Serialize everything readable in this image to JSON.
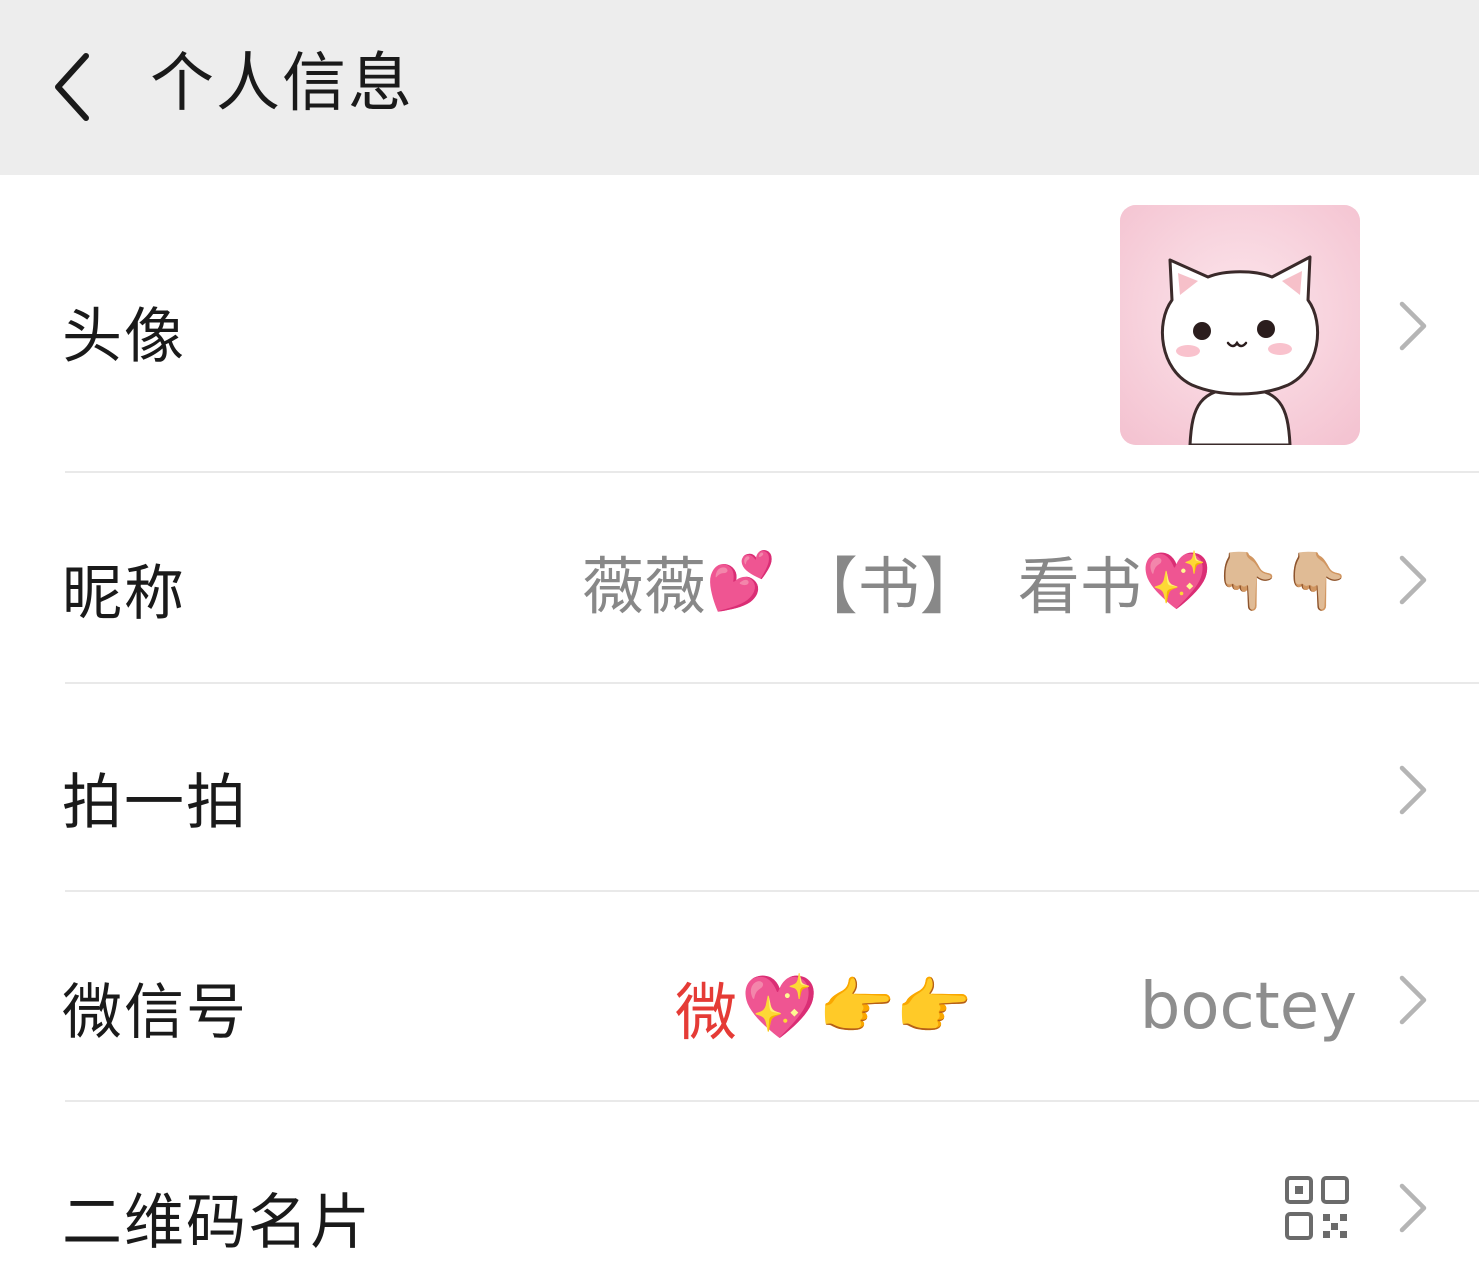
{
  "header": {
    "title": "个人信息"
  },
  "rows": {
    "avatar": {
      "label": "头像"
    },
    "nickname": {
      "label": "昵称",
      "value_text": "薇薇",
      "value_emoji_1": "💕",
      "value_bracket": "【书】",
      "value_text_2": "看书",
      "value_emoji_2": "💖👇🏼👇🏼"
    },
    "pat": {
      "label": "拍一拍"
    },
    "wechat_id": {
      "label": "微信号",
      "decoration_char": "微",
      "decoration_emoji": "💖👉👉",
      "value": "boctey"
    },
    "qr_card": {
      "label": "二维码名片"
    }
  },
  "icons": {
    "back": "chevron-left-icon",
    "row_arrow": "chevron-right-icon",
    "qr": "qr-code-icon"
  },
  "colors": {
    "header_bg": "#ededed",
    "label": "#1a1a1a",
    "value": "#888888",
    "accent_red": "#e53b36",
    "divider": "#e9e9e9"
  }
}
